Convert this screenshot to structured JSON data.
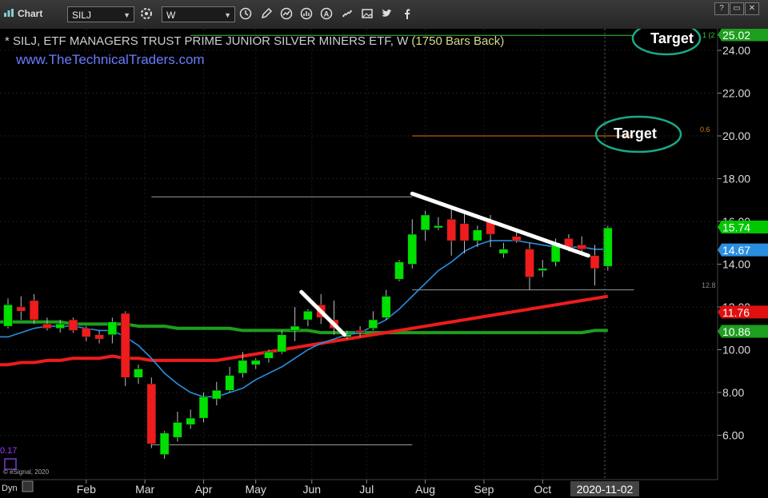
{
  "toolbar": {
    "title": "Chart",
    "symbol": "SILJ",
    "interval": "W",
    "icons": [
      "settings-icon",
      "time-icon",
      "draw-icon",
      "chart-style-icon",
      "alert-icon",
      "link-icon",
      "image-icon",
      "twitter-icon",
      "facebook-icon"
    ]
  },
  "window_controls": [
    "?",
    "▭",
    "✕"
  ],
  "header": {
    "instrument": "* SILJ, ETF MANAGERS TRUST PRIME JUNIOR SILVER MINERS ETF, W",
    "bars_back": "(1750 Bars Back)",
    "website": "www.TheTechnicalTraders.com"
  },
  "footer": {
    "source": "© eSignal, 2020",
    "dyn": "Dyn",
    "side_value": "0.17"
  },
  "annotations": {
    "target_upper": "Target",
    "target_lower": "Target",
    "fib_upper_label": "1 (2",
    "fib_lower_label": "0.6",
    "support_label": "12.8"
  },
  "colors": {
    "up": "#00e000",
    "down": "#ee1c1c",
    "ma_fast": "#2a8fe0",
    "ma_mid": "#ee1c1c",
    "ma_slow": "#1e9e1e",
    "trendline": "#ffffff",
    "fib_upper": "#32c832",
    "fib_lower": "#e07a10",
    "target_ring": "#1aa88a",
    "header_text": "#cfcfcf",
    "website_text": "#6a7cff"
  },
  "chart_data": {
    "type": "candlestick",
    "interval": "W",
    "ylim": [
      5,
      25.5
    ],
    "y_ticks": [
      "24.00",
      "22.00",
      "20.00",
      "18.00",
      "16.00",
      "14.00",
      "12.00",
      "10.00",
      "8.00",
      "6.00"
    ],
    "x_labels": [
      "Feb",
      "Mar",
      "Apr",
      "May",
      "Jun",
      "Jul",
      "Aug",
      "Sep",
      "Oct"
    ],
    "x_label_last": "2020-11-02",
    "price_tags": [
      {
        "label": "25.02",
        "value": 25.02,
        "color": "#1e9e1e"
      },
      {
        "label": "15.74",
        "value": 15.74,
        "color": "#00c800"
      },
      {
        "label": "14.67",
        "value": 14.67,
        "color": "#2a8fe0"
      },
      {
        "label": "11.76",
        "value": 11.76,
        "color": "#e01010"
      },
      {
        "label": "10.86",
        "value": 10.86,
        "color": "#1e9e1e"
      }
    ],
    "candles": [
      {
        "o": 11.1,
        "h": 12.4,
        "l": 11.0,
        "c": 12.1
      },
      {
        "o": 12.0,
        "h": 12.5,
        "l": 11.4,
        "c": 11.8
      },
      {
        "o": 12.3,
        "h": 12.6,
        "l": 11.2,
        "c": 11.4
      },
      {
        "o": 11.2,
        "h": 11.5,
        "l": 10.9,
        "c": 11.0
      },
      {
        "o": 11.0,
        "h": 11.4,
        "l": 10.8,
        "c": 11.2
      },
      {
        "o": 11.4,
        "h": 11.5,
        "l": 10.8,
        "c": 10.9
      },
      {
        "o": 11.0,
        "h": 11.1,
        "l": 10.4,
        "c": 10.6
      },
      {
        "o": 10.7,
        "h": 10.9,
        "l": 10.3,
        "c": 10.5
      },
      {
        "o": 10.7,
        "h": 11.5,
        "l": 10.3,
        "c": 11.3
      },
      {
        "o": 11.7,
        "h": 11.8,
        "l": 8.3,
        "c": 8.7
      },
      {
        "o": 8.7,
        "h": 9.3,
        "l": 8.4,
        "c": 9.1
      },
      {
        "o": 8.4,
        "h": 8.7,
        "l": 5.4,
        "c": 5.6
      },
      {
        "o": 5.1,
        "h": 6.2,
        "l": 4.9,
        "c": 6.1
      },
      {
        "o": 5.9,
        "h": 7.1,
        "l": 5.7,
        "c": 6.6
      },
      {
        "o": 6.5,
        "h": 7.2,
        "l": 6.3,
        "c": 6.8
      },
      {
        "o": 6.8,
        "h": 8.0,
        "l": 6.6,
        "c": 7.8
      },
      {
        "o": 7.7,
        "h": 8.5,
        "l": 7.4,
        "c": 8.1
      },
      {
        "o": 8.1,
        "h": 9.2,
        "l": 8.0,
        "c": 8.8
      },
      {
        "o": 8.9,
        "h": 9.9,
        "l": 8.7,
        "c": 9.5
      },
      {
        "o": 9.3,
        "h": 9.6,
        "l": 9.1,
        "c": 9.5
      },
      {
        "o": 9.6,
        "h": 10.0,
        "l": 9.4,
        "c": 9.9
      },
      {
        "o": 9.9,
        "h": 10.9,
        "l": 9.8,
        "c": 10.7
      },
      {
        "o": 10.9,
        "h": 12.0,
        "l": 10.4,
        "c": 11.1
      },
      {
        "o": 11.4,
        "h": 11.9,
        "l": 11.1,
        "c": 11.8
      },
      {
        "o": 12.1,
        "h": 12.6,
        "l": 11.2,
        "c": 11.5
      },
      {
        "o": 11.4,
        "h": 12.3,
        "l": 10.7,
        "c": 11.0
      },
      {
        "o": 10.6,
        "h": 10.9,
        "l": 10.5,
        "c": 10.7
      },
      {
        "o": 10.9,
        "h": 11.1,
        "l": 10.6,
        "c": 10.8
      },
      {
        "o": 11.0,
        "h": 11.8,
        "l": 10.9,
        "c": 11.4
      },
      {
        "o": 11.5,
        "h": 12.8,
        "l": 11.4,
        "c": 12.5
      },
      {
        "o": 13.3,
        "h": 14.2,
        "l": 13.2,
        "c": 14.1
      },
      {
        "o": 14.0,
        "h": 16.1,
        "l": 13.8,
        "c": 15.4
      },
      {
        "o": 15.6,
        "h": 16.5,
        "l": 15.1,
        "c": 16.3
      },
      {
        "o": 15.7,
        "h": 16.2,
        "l": 15.6,
        "c": 15.8
      },
      {
        "o": 16.1,
        "h": 16.7,
        "l": 14.4,
        "c": 15.1
      },
      {
        "o": 15.9,
        "h": 16.4,
        "l": 14.5,
        "c": 15.1
      },
      {
        "o": 15.1,
        "h": 15.8,
        "l": 14.8,
        "c": 15.6
      },
      {
        "o": 16.0,
        "h": 16.3,
        "l": 14.8,
        "c": 15.4
      },
      {
        "o": 14.5,
        "h": 15.0,
        "l": 14.3,
        "c": 14.7
      },
      {
        "o": 15.3,
        "h": 15.5,
        "l": 15.0,
        "c": 15.1
      },
      {
        "o": 14.7,
        "h": 15.0,
        "l": 12.8,
        "c": 13.4
      },
      {
        "o": 13.7,
        "h": 14.2,
        "l": 13.4,
        "c": 13.8
      },
      {
        "o": 14.1,
        "h": 15.2,
        "l": 13.9,
        "c": 15.0
      },
      {
        "o": 15.2,
        "h": 15.4,
        "l": 14.6,
        "c": 14.8
      },
      {
        "o": 14.9,
        "h": 15.3,
        "l": 14.5,
        "c": 14.7
      },
      {
        "o": 14.4,
        "h": 14.9,
        "l": 13.0,
        "c": 13.8
      },
      {
        "o": 13.9,
        "h": 15.8,
        "l": 13.7,
        "c": 15.7
      }
    ],
    "ma_fast": [
      10.6,
      10.8,
      11.0,
      11.1,
      11.1,
      11.1,
      11.0,
      10.9,
      10.9,
      10.6,
      10.2,
      9.6,
      8.9,
      8.4,
      8.0,
      7.8,
      7.8,
      8.0,
      8.2,
      8.6,
      8.9,
      9.2,
      9.6,
      10.0,
      10.3,
      10.5,
      10.7,
      10.8,
      11.1,
      11.4,
      11.9,
      12.5,
      13.1,
      13.7,
      14.1,
      14.6,
      14.9,
      15.1,
      15.1,
      15.1,
      15.0,
      14.9,
      14.8,
      14.8,
      14.8,
      14.7,
      14.7
    ],
    "ma_mid": [
      9.3,
      9.4,
      9.4,
      9.5,
      9.5,
      9.6,
      9.6,
      9.6,
      9.7,
      9.6,
      9.6,
      9.5,
      9.5,
      9.5,
      9.5,
      9.5,
      9.5,
      9.6,
      9.7,
      9.8,
      9.9,
      10.0,
      10.1,
      10.2,
      10.3,
      10.4,
      10.5,
      10.6,
      10.7,
      10.8,
      10.9,
      11.0,
      11.1,
      11.2,
      11.3,
      11.4,
      11.5,
      11.6,
      11.7,
      11.8,
      11.9,
      12.0,
      12.1,
      12.2,
      12.3,
      12.4,
      12.5
    ],
    "ma_slow": [
      11.3,
      11.3,
      11.3,
      11.3,
      11.3,
      11.2,
      11.2,
      11.2,
      11.2,
      11.2,
      11.1,
      11.1,
      11.1,
      11.0,
      11.0,
      11.0,
      11.0,
      11.0,
      10.9,
      10.9,
      10.9,
      10.9,
      10.9,
      10.9,
      10.8,
      10.8,
      10.8,
      10.8,
      10.8,
      10.8,
      10.8,
      10.8,
      10.8,
      10.8,
      10.8,
      10.8,
      10.8,
      10.8,
      10.8,
      10.8,
      10.8,
      10.8,
      10.8,
      10.8,
      10.8,
      10.9,
      10.9
    ],
    "horizontal_lines": [
      {
        "name": "fib-1-target-line",
        "value": 24.7,
        "from": 14,
        "to": 48
      },
      {
        "name": "fib-0.6-target-line",
        "value": 20.0,
        "from": 31,
        "to": 48
      },
      {
        "name": "resistance-high-line",
        "value": 17.15,
        "from": 11,
        "to": 31
      },
      {
        "name": "support-line",
        "value": 12.8,
        "from": 31,
        "to": 48
      },
      {
        "name": "march-low-line",
        "value": 5.55,
        "from": 11,
        "to": 31
      }
    ],
    "trendlines": [
      {
        "name": "descending-trendline",
        "from": [
          31,
          17.3
        ],
        "to": [
          44.5,
          14.4
        ]
      },
      {
        "name": "pullback-trendline",
        "from": [
          22.5,
          12.7
        ],
        "to": [
          25.8,
          10.7
        ]
      }
    ]
  }
}
